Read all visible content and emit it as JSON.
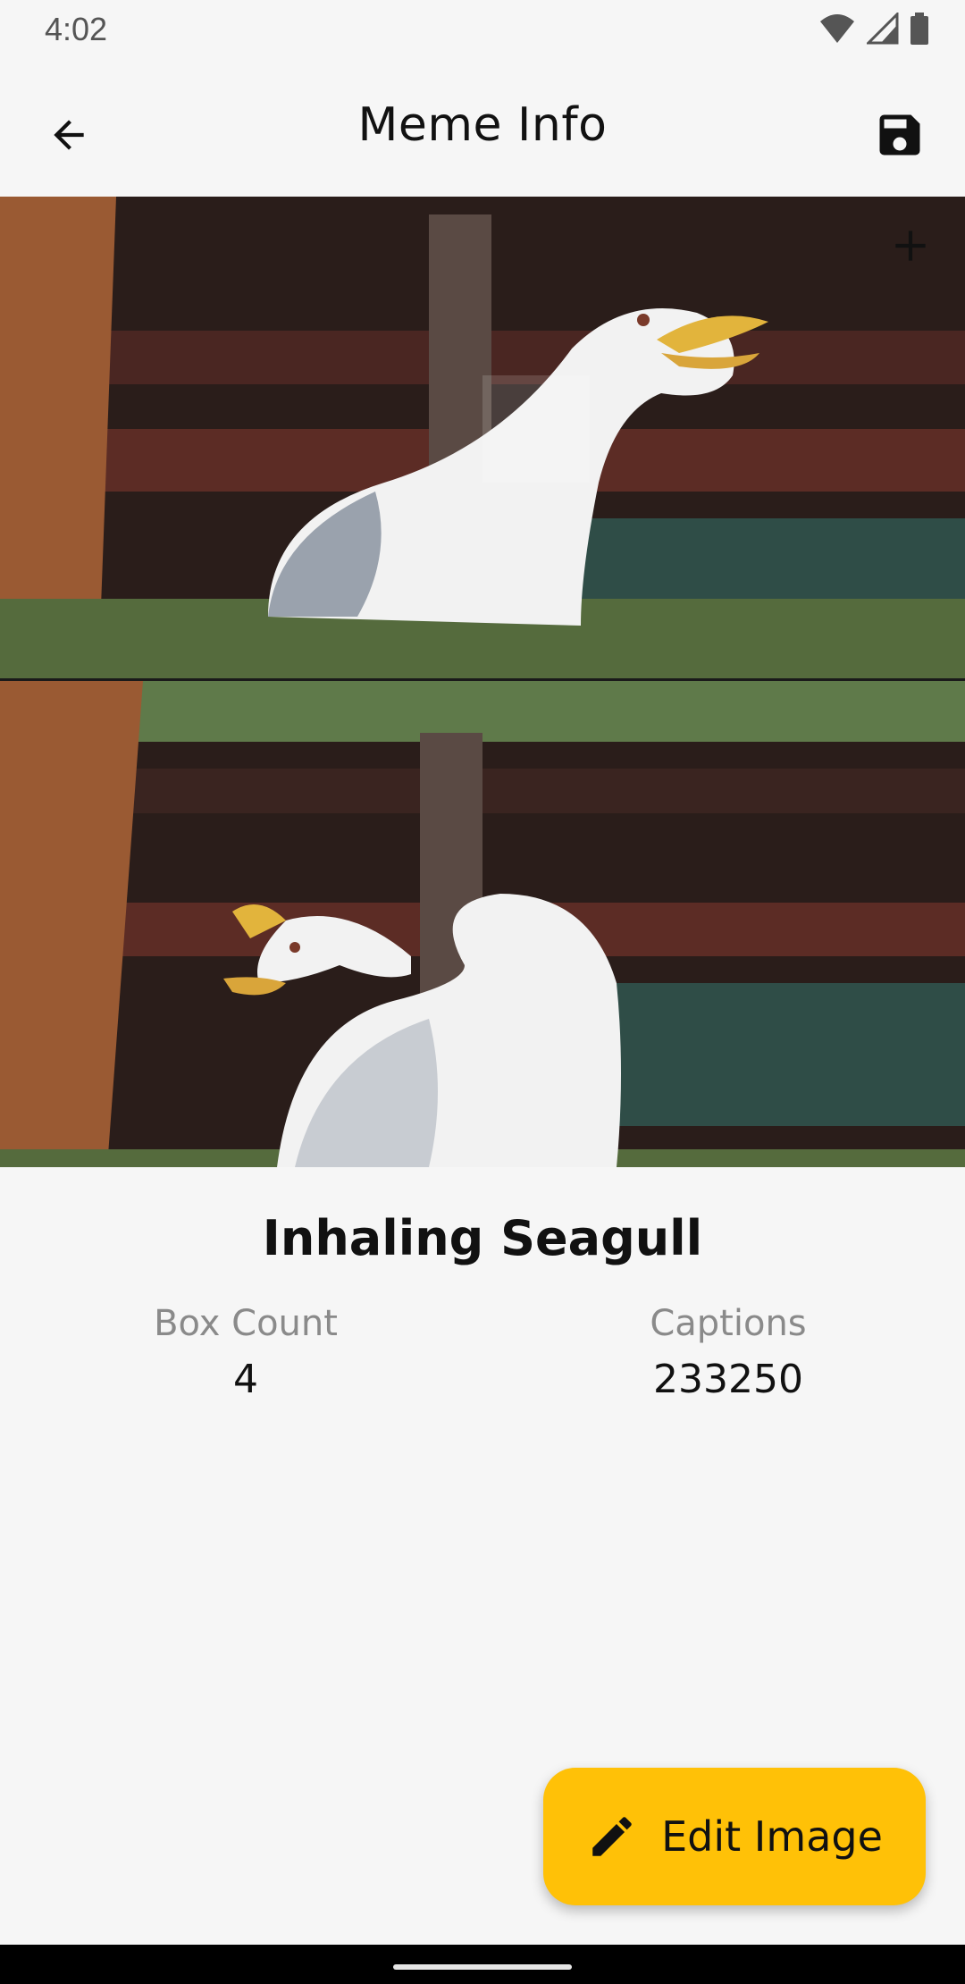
{
  "status_bar": {
    "time": "4:02",
    "icons": [
      "wifi-icon",
      "signal-icon",
      "battery-icon"
    ]
  },
  "app_bar": {
    "title": "Meme Info",
    "back_icon": "arrow-left-icon",
    "save_icon": "floppy-disk-icon"
  },
  "meme": {
    "name": "Inhaling Seagull",
    "box_count_label": "Box Count",
    "box_count": "4",
    "captions_label": "Captions",
    "captions": "233250"
  },
  "fab": {
    "label": "Edit Image",
    "icon": "pencil-icon",
    "color": "#ffc107"
  }
}
